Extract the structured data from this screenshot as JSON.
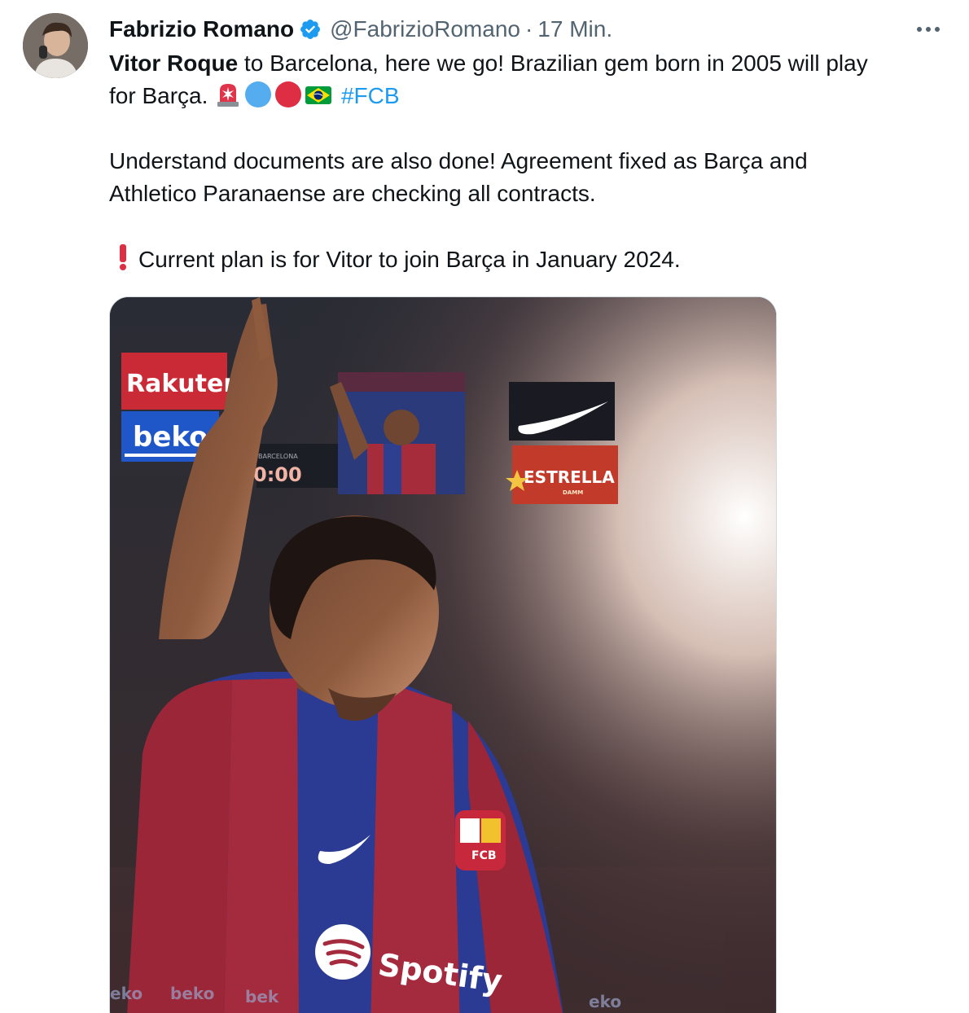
{
  "author": {
    "name": "Fabrizio Romano",
    "handle": "@FabrizioRomano",
    "separator": "·",
    "time": "17 Min.",
    "verified_icon": "verified-badge-icon",
    "avatar_icon": "profile-avatar"
  },
  "menu": {
    "icon": "more-options-icon"
  },
  "tweet": {
    "line1_bold": "Vitor Roque",
    "line1_rest": " to Barcelona, here we go! Brazilian gem born in 2005 will play",
    "line2_text": "for Barça. ",
    "hashtag": "#FCB",
    "paragraph2_line1": "Understand documents are also done! Agreement fixed as Barça and",
    "paragraph2_line2": "Athletico Paranaense are checking all contracts.",
    "paragraph3_mark": "❗",
    "paragraph3_text": "Current plan is for Vitor to join Barça in January 2024.",
    "emojis": [
      "rotating-light-icon",
      "blue-circle-icon",
      "red-circle-icon",
      "brazil-flag-icon"
    ]
  },
  "media": {
    "board_left_top": "Rakuten",
    "board_left_bottom": "beko",
    "scoreboard_time": "0:00",
    "scoreboard_small": "BARCELONA",
    "board_right_brand": "ESTRELLA",
    "board_right_sub": "DAMM",
    "jersey_sponsor": "Spotify",
    "crest_text": "FCB",
    "footer_ads": [
      "eko",
      "beko",
      "bek",
      "eko"
    ]
  }
}
